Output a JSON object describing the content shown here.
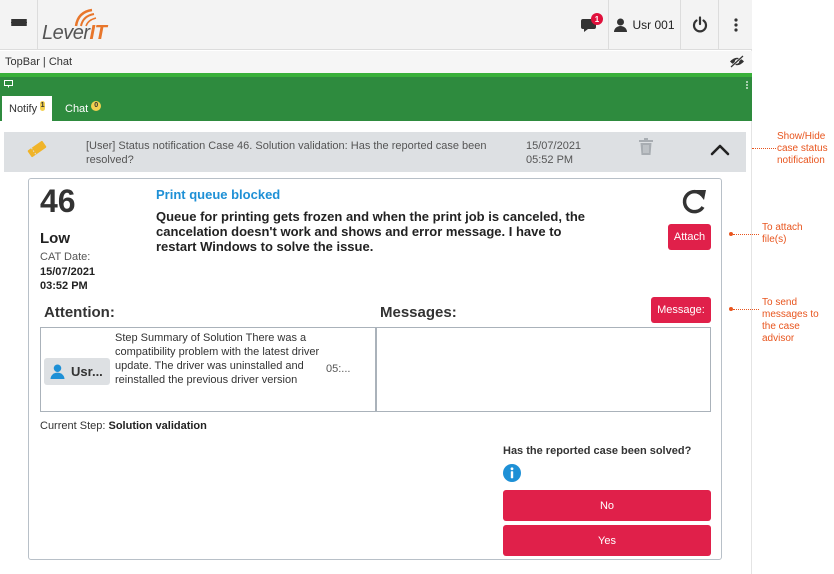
{
  "topbar": {
    "logo_text_a": "Lever",
    "logo_text_b": "IT",
    "chat_badge": "1",
    "user_label": "Usr 001"
  },
  "breadcrumb": "TopBar | Chat",
  "tabs": [
    {
      "label": "Notify",
      "badge": "1"
    },
    {
      "label": "Chat",
      "badge": "0"
    }
  ],
  "notification": {
    "text": "[User] Status notification Case 46. Solution validation: Has the reported case been resolved?",
    "date": "15/07/2021",
    "time": "05:52 PM"
  },
  "case": {
    "number": "46",
    "priority": "Low",
    "cat_label": "CAT Date:",
    "cat_date": "15/07/2021",
    "cat_time": "03:52 PM",
    "title": "Print queue blocked",
    "description": "Queue for printing gets frozen and when the print job is canceled, the cancelation doesn't work and shows and error message. I have to restart Windows to solve the issue.",
    "attach_label": "Attach",
    "message_label": "Message:",
    "attention_label": "Attention:",
    "messages_label": "Messages:",
    "attention_item": {
      "user": "Usr...",
      "text": "Step Summary of Solution There was a compatibility problem with the latest driver update. The driver was uninstalled and reinstalled the previous driver version",
      "time": "05:..."
    },
    "current_step_label": "Current Step:",
    "current_step_value": "Solution validation",
    "question": "Has the reported case been solved?",
    "no_label": "No",
    "yes_label": "Yes"
  },
  "annotations": {
    "show_hide": "Show/Hide case status notification",
    "attach": "To attach file(s)",
    "send": "To send messages to the case advisor"
  },
  "colors": {
    "accent_red": "#e0204a",
    "green": "#2e8b3e",
    "link_blue": "#1e90d6",
    "annotation_orange": "#e8551e"
  }
}
